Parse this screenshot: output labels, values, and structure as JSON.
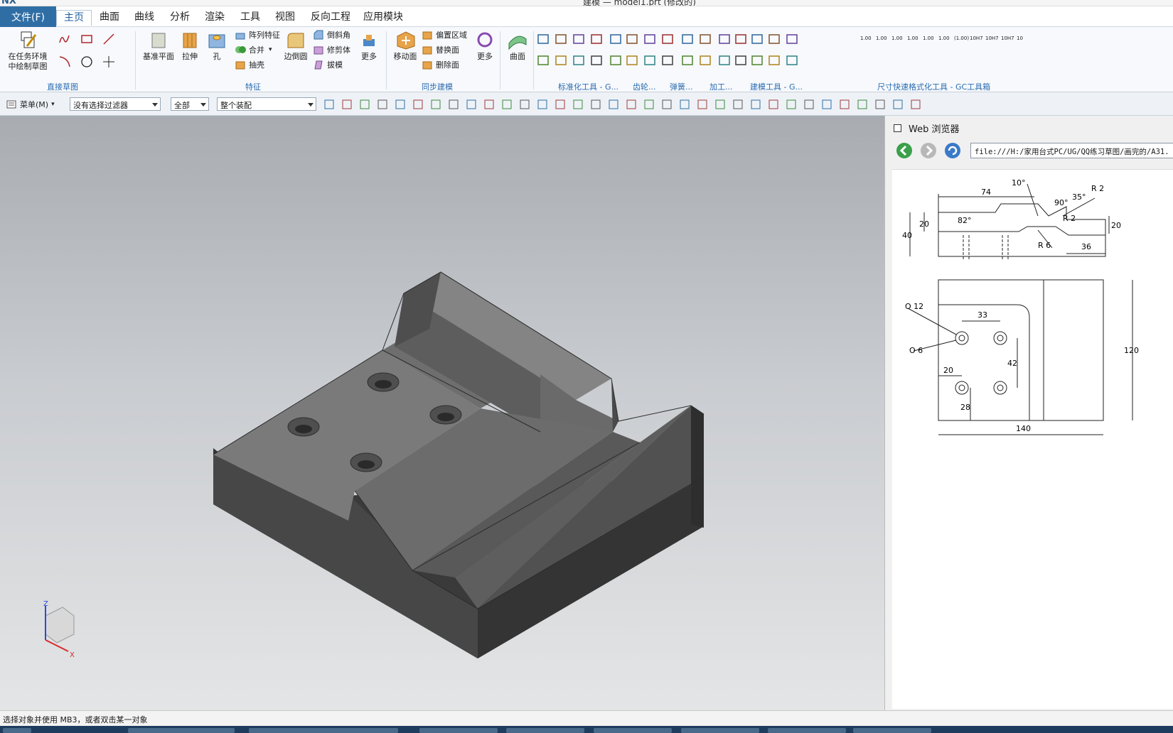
{
  "titlebar": {
    "logo": "NX",
    "title": "建模 — model1.prt (修改的)"
  },
  "menubar": {
    "file": "文件(F)",
    "tabs": [
      "主页",
      "曲面",
      "曲线",
      "分析",
      "渲染",
      "工具",
      "视图",
      "反向工程",
      "应用模块"
    ],
    "active_tab": "主页"
  },
  "ribbon": {
    "sketch_task": "在任务环境中绘制草图",
    "groups": {
      "direct_sketch": "直接草图",
      "feature": "特征",
      "sync_modeling": "同步建模",
      "std_tools": "标准化工具 - G...",
      "gear": "齿轮...",
      "spring": "弹簧...",
      "machining": "加工...",
      "modeling_tools": "建模工具 - G...",
      "dim_format": "尺寸快速格式化工具 - GC工具箱"
    },
    "feature_buttons": {
      "datum_plane": "基准平面",
      "extrude": "拉伸",
      "hole": "孔",
      "more": "更多",
      "edge_blend": "边倒圆"
    },
    "feature_small": {
      "pattern": "阵列特征",
      "unite": "合并",
      "shell": "抽壳",
      "chamfer": "倒斜角",
      "trim_body": "修剪体",
      "draft": "拔模"
    },
    "sync_buttons": {
      "move_face": "移动面",
      "more": "更多",
      "surface": "曲面"
    },
    "sync_small": {
      "offset_region": "偏置区域",
      "replace_face": "替换面",
      "delete_face": "删除面"
    },
    "dim_labels": [
      "1.00",
      "1.00",
      "1.00",
      "1.00",
      "1.00",
      "1.00",
      "(1.00)",
      "10H7",
      "10H7",
      "10H7",
      "10"
    ]
  },
  "toolbar2": {
    "menu_label": "菜单(M)",
    "filter": "没有选择过滤器",
    "scope": "全部",
    "assembly": "整个装配"
  },
  "webpanel": {
    "title": "Web 浏览器",
    "url": "file:///H:/家用台式PC/UG/QQ练习草图/画完的/A31.",
    "drawing": {
      "top_view": {
        "d74": "74",
        "d10": "10°",
        "d90": "90°",
        "d35": "35°",
        "r2a": "R 2",
        "r2b": "R 2",
        "r6": "R 6",
        "d82": "82°",
        "d20a": "20",
        "d40": "40",
        "d20b": "20",
        "d36": "36"
      },
      "plan_view": {
        "o12": "O 12",
        "o6": "O 6",
        "d33": "33",
        "d42": "42",
        "d20": "20",
        "d28": "28",
        "d120": "120",
        "d140": "140"
      }
    }
  },
  "axes": {
    "z": "Z",
    "x": "X"
  },
  "statusbar": {
    "text": "选择对象并使用 MB3，或者双击某一对象"
  },
  "colors": {
    "accent": "#2f6ea5",
    "part_face": "#5a5a5a",
    "label_blue": "#2b6cb0"
  }
}
